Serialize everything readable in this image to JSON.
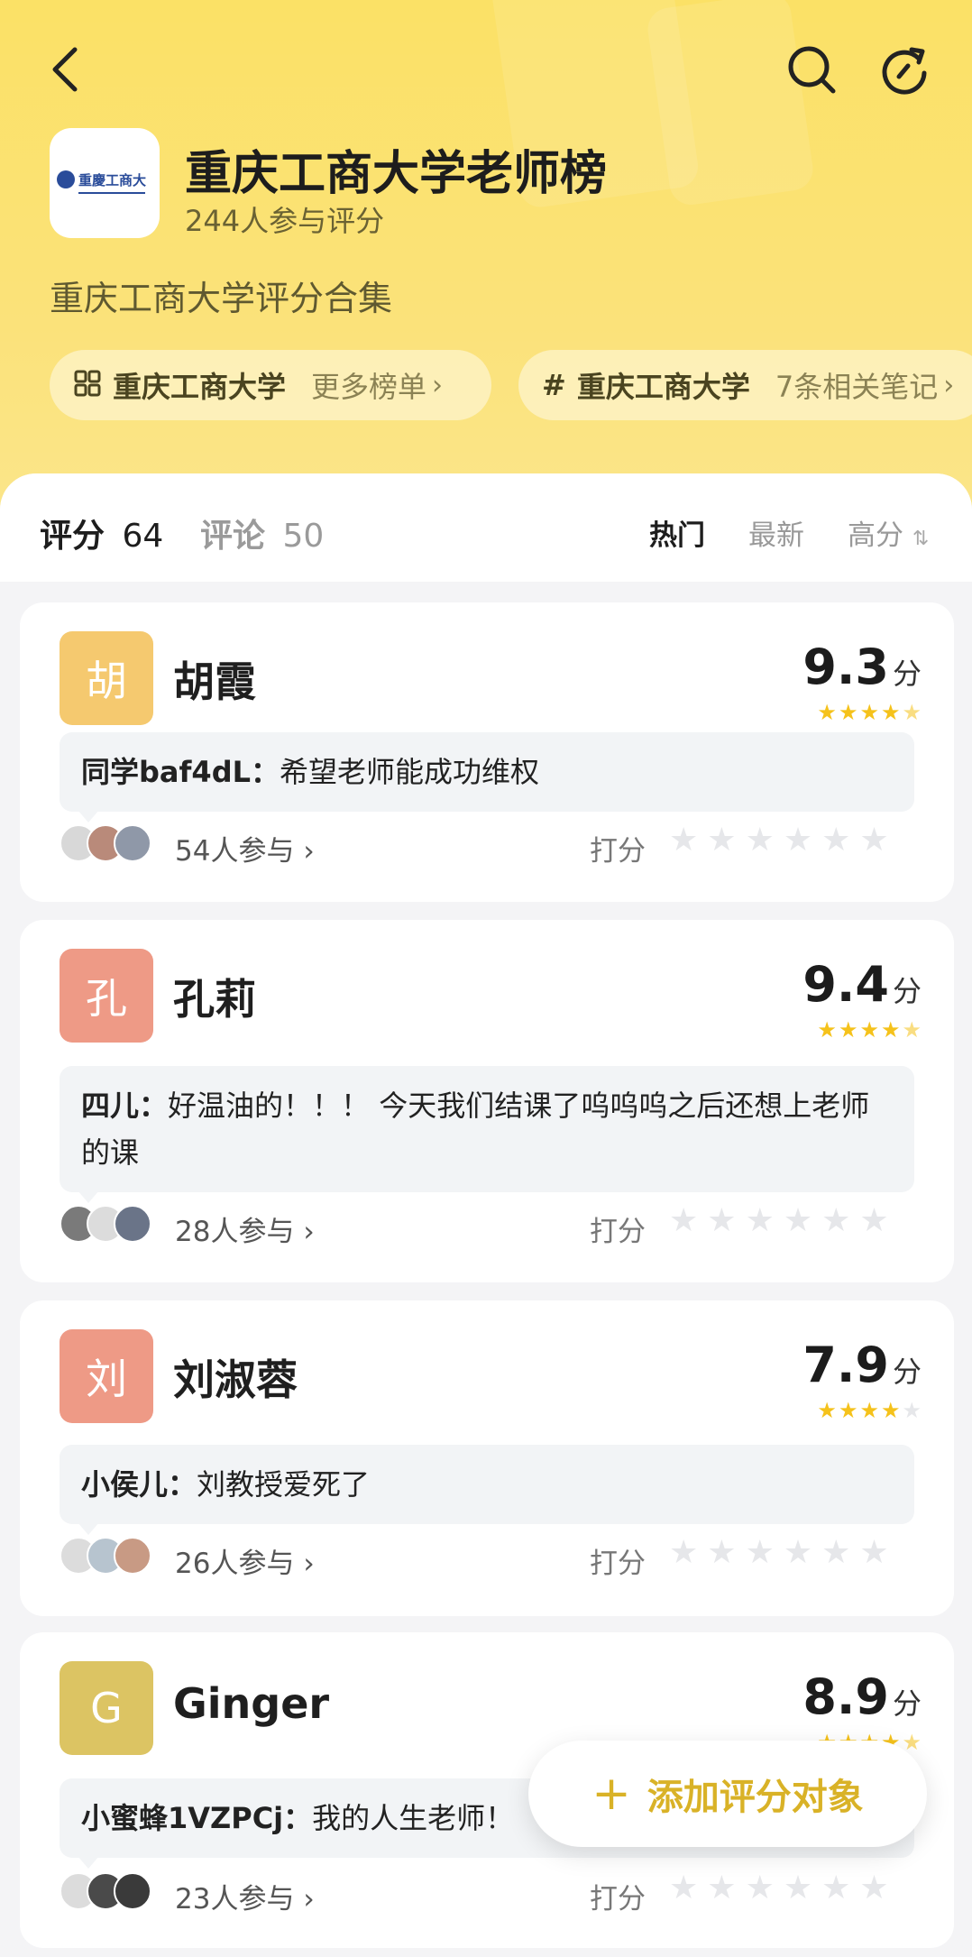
{
  "header": {
    "title": "重庆工商大学老师榜",
    "participants": "244人参与评分",
    "subtitle": "重庆工商大学评分合集",
    "logo_text": "重慶工商大",
    "chips": [
      {
        "icon": "grid-icon",
        "strong": "重庆工商大学",
        "light": "更多榜单"
      },
      {
        "icon": "hash-icon",
        "strong": "重庆工商大学",
        "light": "7条相关笔记"
      }
    ]
  },
  "tabs": {
    "ratings_label": "评分",
    "ratings_count": "64",
    "comments_label": "评论",
    "comments_count": "50"
  },
  "sort": {
    "hot": "热门",
    "newest": "最新",
    "highest": "高分"
  },
  "rate_label": "打分",
  "cards": [
    {
      "initial": "胡",
      "name": "胡霞",
      "score": "9.3",
      "unit": "分",
      "rating_stars": 4.5,
      "comment_author": "同学baf4dL：",
      "comment_text": "希望老师能成功维权",
      "count": "54人参与",
      "avatar_color": "#f5c96f"
    },
    {
      "initial": "孔",
      "name": "孔莉",
      "score": "9.4",
      "unit": "分",
      "rating_stars": 4.5,
      "comment_author": "四儿：",
      "comment_text": "好温油的！！！ 今天我们结课了呜呜呜之后还想上老师的课",
      "count": "28人参与",
      "avatar_color": "#ee9a86"
    },
    {
      "initial": "刘",
      "name": "刘淑蓉",
      "score": "7.9",
      "unit": "分",
      "rating_stars": 4,
      "comment_author": "小侯儿：",
      "comment_text": "刘教授爱死了",
      "count": "26人参与",
      "avatar_color": "#ee9a86"
    },
    {
      "initial": "G",
      "name": "Ginger",
      "score": "8.9",
      "unit": "分",
      "rating_stars": 4.5,
      "comment_author": "小蜜蜂1VZPCj：",
      "comment_text": "我的人生老师！",
      "count": "23人参与",
      "avatar_color": "#dcc463"
    }
  ],
  "fab": {
    "label": "添加评分对象"
  }
}
